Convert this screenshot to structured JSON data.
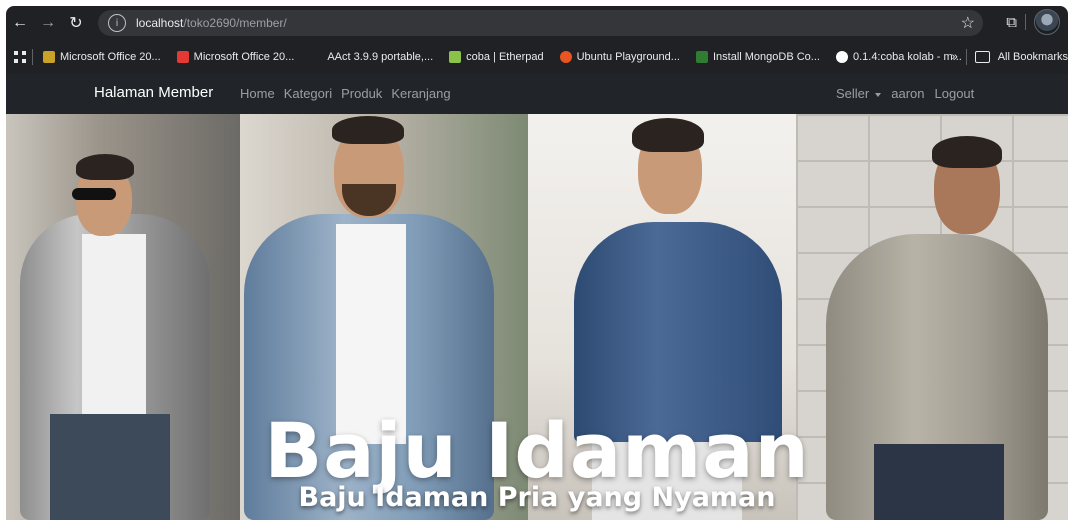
{
  "browser": {
    "url_host": "localhost",
    "url_path": "/toko2690/member/",
    "bookmarks": [
      {
        "label": "Microsoft Office 20...",
        "color": "#c9a227"
      },
      {
        "label": "Microsoft Office 20...",
        "color": "#e53935"
      },
      {
        "label": "AAct 3.9.9 portable,...",
        "color": "#202124"
      },
      {
        "label": "coba | Etherpad",
        "color": "#8bc34a"
      },
      {
        "label": "Ubuntu Playground...",
        "color": "#e95420"
      },
      {
        "label": "Install MongoDB Co...",
        "color": "#2e7d32"
      },
      {
        "label": "0.1.4:coba kolab - m...",
        "color": "#ffffff"
      }
    ],
    "more_label": "»",
    "all_bookmarks": "All Bookmarks"
  },
  "navbar": {
    "brand": "Halaman Member",
    "links": [
      "Home",
      "Kategori",
      "Produk",
      "Keranjang"
    ],
    "seller": "Seller",
    "user": "aaron",
    "logout": "Logout"
  },
  "hero": {
    "title": "Baju Idaman",
    "subtitle": "Baju Idaman Pria yang Nyaman"
  }
}
